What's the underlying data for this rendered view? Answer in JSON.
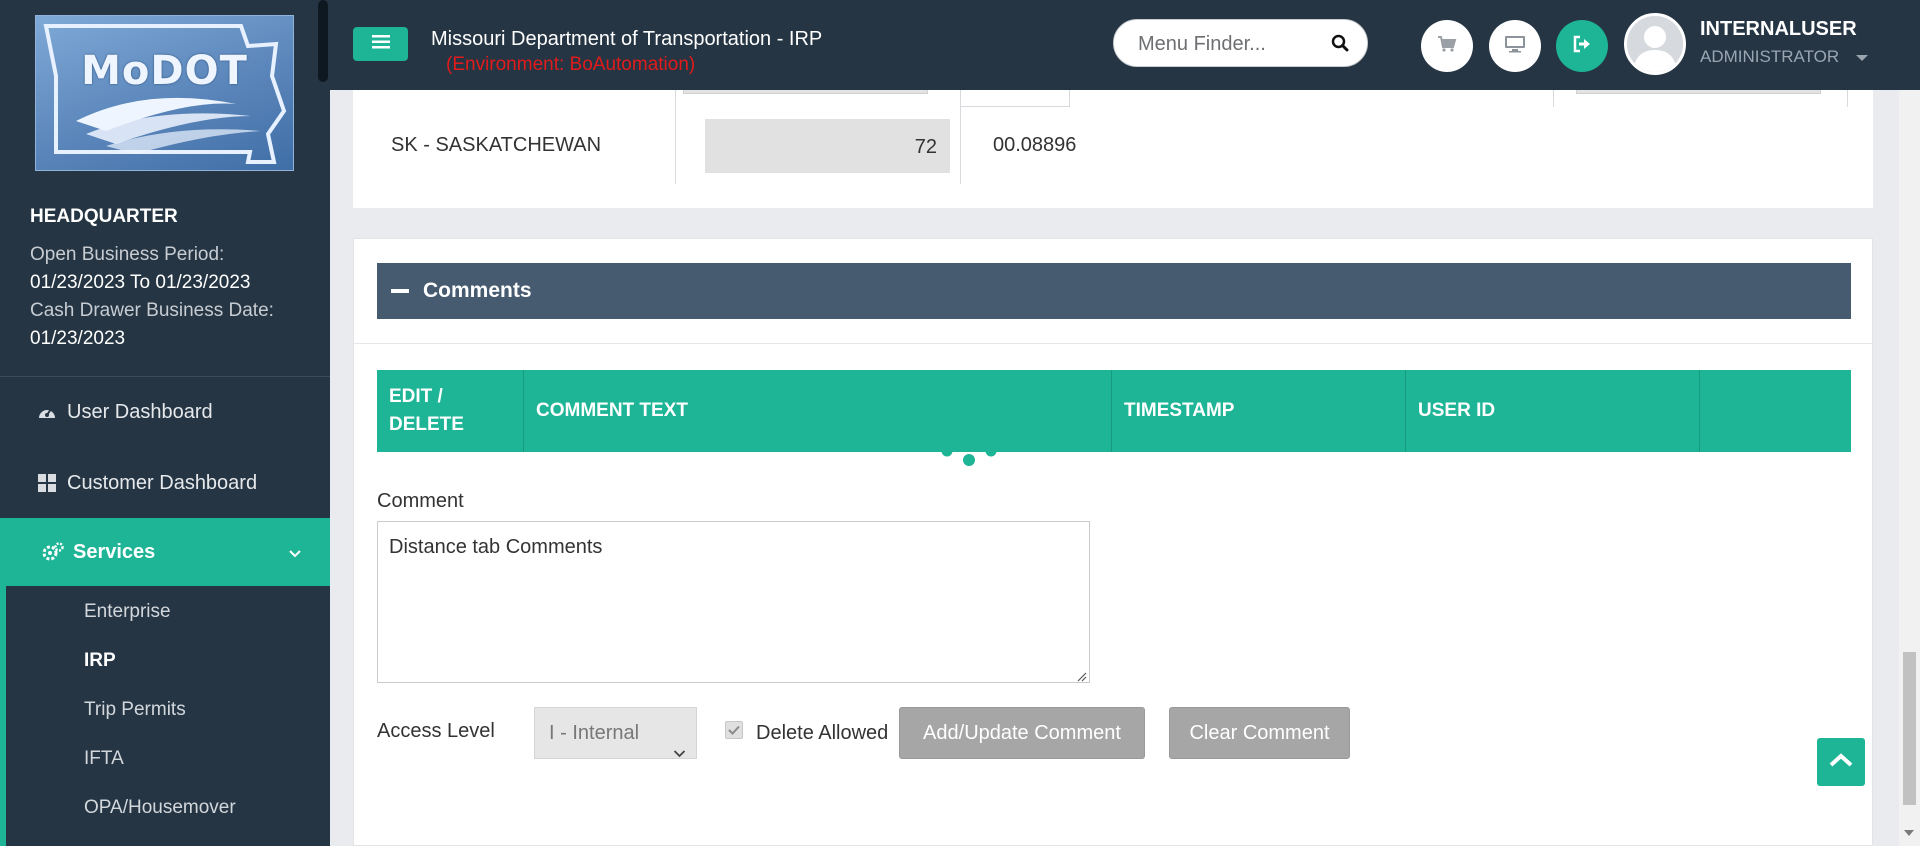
{
  "sidebar": {
    "logo_text": "MoDOT",
    "office": "HEADQUARTER",
    "open_period_label": "Open Business Period:",
    "open_period_value": "01/23/2023 To 01/23/2023",
    "cash_drawer_label": "Cash Drawer Business Date:",
    "cash_drawer_value": "01/23/2023",
    "nav": [
      {
        "label": "User Dashboard",
        "icon": "dashboard-gauge-icon"
      },
      {
        "label": "Customer Dashboard",
        "icon": "grid-icon"
      },
      {
        "label": "Services",
        "icon": "gears-icon"
      }
    ],
    "sub_items": [
      {
        "label": "Enterprise"
      },
      {
        "label": "IRP"
      },
      {
        "label": "Trip Permits"
      },
      {
        "label": "IFTA"
      },
      {
        "label": "OPA/Housemover"
      }
    ]
  },
  "header": {
    "title": "Missouri Department of Transportation - IRP",
    "environment": "(Environment: BoAutomation)",
    "menu_finder_placeholder": "Menu Finder...",
    "user_name": "INTERNALUSER",
    "user_role": "ADMINISTRATOR"
  },
  "distance": {
    "jurisdiction": "SK - SASKATCHEWAN",
    "miles": "72",
    "percent": "00.08896"
  },
  "comments": {
    "title": "Comments",
    "columns": [
      "EDIT / DELETE",
      "COMMENT TEXT",
      "TIMESTAMP",
      "USER ID",
      ""
    ],
    "comment_label": "Comment",
    "comment_value": "Distance tab Comments",
    "access_level_label": "Access Level",
    "access_level_value": "I - Internal",
    "delete_allowed_label": "Delete Allowed",
    "delete_allowed_checked": true,
    "add_update_label": "Add/Update Comment",
    "clear_label": "Clear Comment"
  },
  "colors": {
    "accent": "#1eb496",
    "sidebar_bg": "#253543",
    "panel_header": "#465a70",
    "environment_text": "#e11b1b"
  }
}
